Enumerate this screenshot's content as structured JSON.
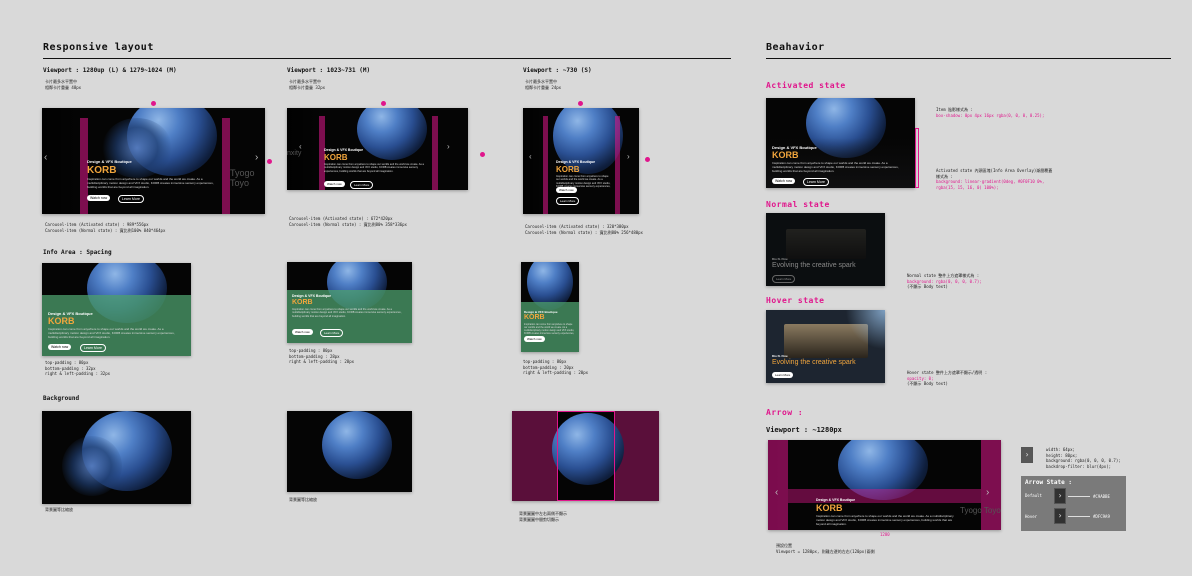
{
  "sections": {
    "responsive_title": "Responsive layout",
    "behavior_title": "Beahavior",
    "info_area_title": "Info Area : Spacing",
    "background_title": "Background"
  },
  "viewports": {
    "large": "Viewport : 1280up (L) & 1279~1024 (M)",
    "medium": "Viewport : 1023~731 (M)",
    "small": "Viewport : ~730 (S)"
  },
  "card": {
    "tag": "Design & VFX Boutique",
    "title": "KORB",
    "description": "Inspiration can come from anywhere to shape our worlds and the world we create. As a multidisciplinary motion design and VFX studio, KORB creates immersive sensory experiences, building worlds that are beyond all imagination.",
    "watch_label": "Watch now",
    "learn_label": "Learn More",
    "side_text": "Tyogo Toyo",
    "side_text_m": "nxity"
  },
  "notes": {
    "large_top": [
      "卡片最多水平置中",
      "相鄰卡片重疊 48px"
    ],
    "medium_top": [
      "卡片最多水平置中",
      "相鄰卡片重疊 32px"
    ],
    "small_top": [
      "卡片最多水平置中",
      "相鄰卡片重疊 24px"
    ],
    "large_bottom": [
      "Carousel-item (Activated state) : 989*556px",
      "Carousel-item (Normal state) : 寬比例100% 840*464px"
    ],
    "medium_bottom": [
      "Carousel-item (Activated state) : 672*420px",
      "Carousel-item (Normal state) : 寬比例80% 358*336px"
    ],
    "small_bottom": [
      "Carousel-item (Activated state) : 320*380px",
      "Carousel-item (Normal state) : 寬比例80% 256*480px"
    ],
    "pad_l": [
      "top-padding : 80px",
      "bottom-padding : 32px",
      "right & left-padding : 32px"
    ],
    "pad_m": [
      "top-padding : 80px",
      "bottom-padding : 28px",
      "right & left-padding : 28px"
    ],
    "pad_s": [
      "top-padding : 80px",
      "bottom-padding : 20px",
      "right & left-padding : 20px"
    ],
    "bg_l": "背景圖等比縮放",
    "bg_m": "背景圖等比縮放",
    "bg_s": [
      "背景圖圖中左右兩側不顯示",
      "背景圖圖中間剪切顯示"
    ]
  },
  "behavior": {
    "activated_title": "Activated state",
    "activated_notes": [
      "Item 陰影樣式為 :",
      "box-shadow: 0px 4px 16px rgba(0, 0, 0, 0.25);"
    ],
    "overlay_notes": [
      "Activated state 內頭區塊(Info Area Overlay)漸層覆蓋樣式為 :",
      "background: linear-gradient(0deg, #0F0F10 0%, rgba(15, 15, 16, 0) 100%);"
    ],
    "normal_title": "Normal state",
    "normal_tag": "Dio N. Fine",
    "normal_heading": "Evolving the creative spark",
    "normal_notes": [
      "Normal state 整件上方遮罩樣式為 :",
      "background: rgba(0, 0, 0, 0.7);",
      "(不顯示 Body text)"
    ],
    "hover_title": "Hover state",
    "hover_tag": "Dio N. Fine",
    "hover_heading": "Evolving the creative spark",
    "hover_notes": [
      "Hover state 整件上方遮罩不顯示/透明 :",
      "opacity: 0;",
      "(不顯示 Body text)"
    ],
    "arrow_title": "Arrow :",
    "arrow_viewport": "Viewport : ~1280px",
    "arrow_width_label": "1280",
    "arrow_specs": [
      "width: 64px;",
      "height: 80px;",
      "background: rgba(0, 0, 0, 0.7);",
      "backdrop-filter: blur(4px);"
    ],
    "arrow_state_title": "Arrow State :",
    "arrow_default": "Default",
    "arrow_hover": "Hover",
    "arrow_default_color": "#C9ABBE",
    "arrow_hover_color": "#DFC9A9",
    "arrow_bottom_notes": [
      "預設位置",
      "Viewport = 1280px, 則離左邊的左右(120px)兩側"
    ]
  },
  "colors": {
    "accent": "#e0168c",
    "title_orange": "#f2a63d",
    "green": "#4ea06e"
  }
}
